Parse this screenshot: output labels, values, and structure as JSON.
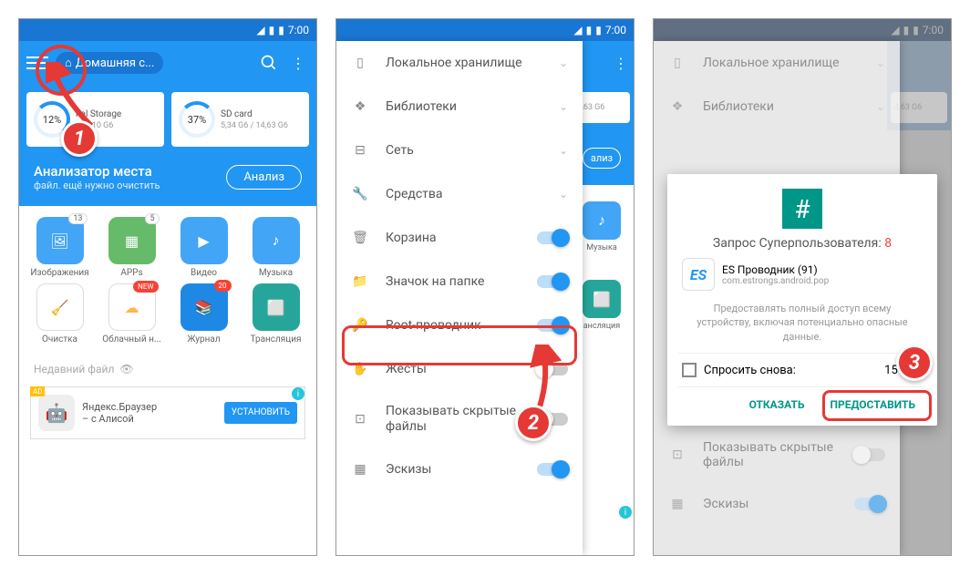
{
  "status": {
    "time": "7:00"
  },
  "header": {
    "home_tab": "Домашняя с...",
    "home_icon": "⌂"
  },
  "storage": {
    "card1": {
      "pct": "12%",
      "name": "nal Storage",
      "size": "/ 11,10 G6"
    },
    "card2": {
      "pct": "37%",
      "name": "SD card",
      "size": "5,34 G6 / 14,63 G6"
    }
  },
  "analyzer": {
    "title": "Анализатор места",
    "subtitle": "файл. ещё нужно очистить",
    "btn": "Анализ"
  },
  "grid": {
    "images": "Изображения",
    "apps": "APPs",
    "video": "Видео",
    "music": "Музыка",
    "cleanup": "Очистка",
    "cloud": "Облачный н...",
    "log": "Журнал",
    "cast": "Трансляция",
    "badge_images": "13",
    "badge_apps": "5",
    "badge_cloud": "NEW",
    "badge_log": "20"
  },
  "recent": "Недавний файл",
  "ad": {
    "title": "Яндекс.Браузер",
    "subtitle": "– с Алисой",
    "btn": "УСТАНОВИТЬ",
    "label": "AD"
  },
  "sidebar": {
    "local": "Локальное хранилище",
    "libs": "Библиотеки",
    "network": "Сеть",
    "tools": "Средства",
    "trash": "Корзина",
    "folder_icon": "Значок на папке",
    "root": "Root-проводник",
    "gestures": "Жесты",
    "hidden": "Показывать скрытые файлы",
    "thumbs": "Эскизы"
  },
  "bg_right": {
    "storage_size": "4,63 G6",
    "music": "Музыка",
    "cast": "ансляция",
    "analyze": "ализ"
  },
  "dialog": {
    "title_prefix": "Запрос Суперпользователя: ",
    "title_num": "8",
    "app_name": "ES Проводник (91)",
    "package": "com.estrongs.android.pop",
    "desc": "Предоставлять полный доступ всему устройству, включая потенциально опасные данные.",
    "ask_label": "Спросить снова:",
    "ask_time": "15 ми..",
    "deny": "ОТКАЗАТЬ",
    "grant": "ПРЕДОСТАВИТЬ"
  }
}
